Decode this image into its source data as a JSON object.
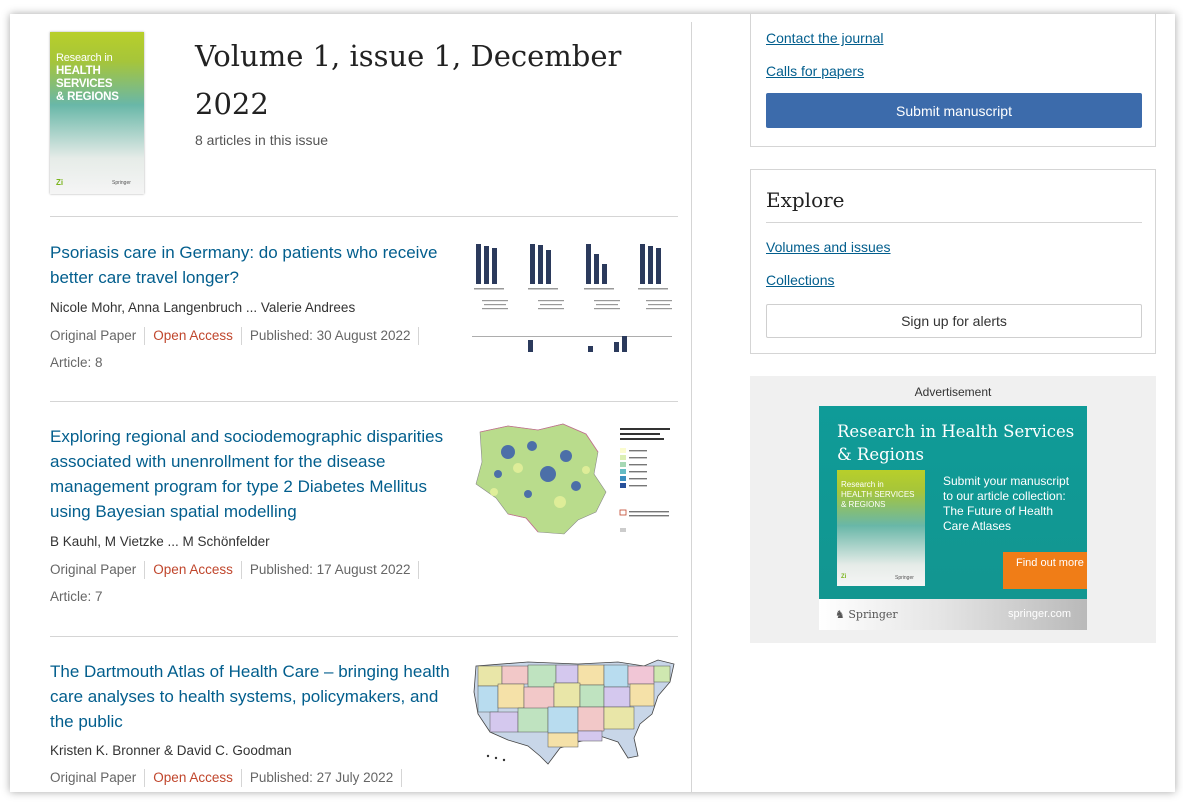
{
  "issue": {
    "title": "Volume 1, issue 1, December 2022",
    "article_count": "8 articles in this issue",
    "cover": {
      "title_line1": "Research in",
      "title_line2": "HEALTH SERVICES",
      "title_line3": "& REGIONS",
      "publisher_mark": "Zi",
      "publisher": "Springer"
    }
  },
  "articles": [
    {
      "title": "Psoriasis care in Germany: do patients who receive better care travel longer?",
      "authors": "Nicole Mohr, Anna Langenbruch ... Valerie Andrees",
      "type": "Original Paper",
      "access": "Open Access",
      "published": "Published: 30 August 2022",
      "article_number": "Article: 8"
    },
    {
      "title": "Exploring regional and sociodemographic disparities associated with unenrollment for the disease management program for type 2 Diabetes Mellitus using Bayesian spatial modelling",
      "authors": "B Kauhl, M Vietzke ... M Schönfelder",
      "type": "Original Paper",
      "access": "Open Access",
      "published": "Published: 17 August 2022",
      "article_number": "Article: 7"
    },
    {
      "title": "The Dartmouth Atlas of Health Care – bringing health care analyses to health systems, policymakers, and the public",
      "authors": "Kristen K. Bronner & David C. Goodman",
      "type": "Original Paper",
      "access": "Open Access",
      "published": "Published: 27 July 2022"
    }
  ],
  "sidebar": {
    "contact_link": "Contact the journal",
    "calls_link": "Calls for papers",
    "submit_button": "Submit manuscript",
    "explore_title": "Explore",
    "volumes_link": "Volumes and issues",
    "collections_link": "Collections",
    "alerts_button": "Sign up for alerts"
  },
  "ad": {
    "label": "Advertisement",
    "title": "Research in Health Services & Regions",
    "text": "Submit your manuscript to our article collection: The Future of Health Care Atlases",
    "cta": "Find out more",
    "brand": "Springer",
    "url": "springer.com",
    "cover_title_line1": "Research in",
    "cover_title_line2": "HEALTH SERVICES",
    "cover_title_line3": "& REGIONS",
    "cover_mark": "Zi",
    "cover_publisher": "Springer"
  },
  "colors": {
    "link": "#025e8d",
    "open_access": "#c0462c",
    "primary_button": "#3c6bab",
    "ad_background": "#13958f",
    "ad_cta": "#f07d17"
  }
}
